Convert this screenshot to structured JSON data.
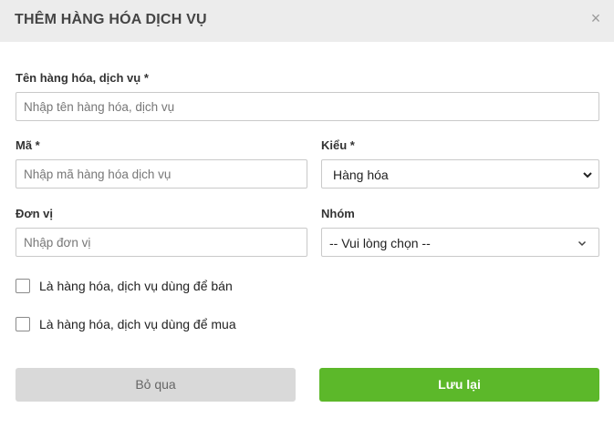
{
  "dialog": {
    "title": "THÊM HÀNG HÓA DỊCH VỤ",
    "close_glyph": "×"
  },
  "form": {
    "name": {
      "label": "Tên hàng hóa, dịch vụ *",
      "placeholder": "Nhập tên hàng hóa, dịch vụ",
      "value": ""
    },
    "code": {
      "label": "Mã *",
      "placeholder": "Nhập mã hàng hóa dịch vụ",
      "value": ""
    },
    "type": {
      "label": "Kiểu *",
      "selected": "Hàng hóa"
    },
    "unit": {
      "label": "Đơn vị",
      "placeholder": "Nhập đơn vị",
      "value": ""
    },
    "group": {
      "label": "Nhóm",
      "selected": "-- Vui lòng chọn --"
    },
    "for_sale": {
      "label": "Là hàng hóa, dịch vụ dùng để bán",
      "checked": false
    },
    "for_purchase": {
      "label": "Là hàng hóa, dịch vụ dùng để mua",
      "checked": false
    }
  },
  "buttons": {
    "cancel_label": "Bỏ qua",
    "save_label": "Lưu lại"
  },
  "colors": {
    "header_bg": "#ececec",
    "primary": "#5cb82a",
    "secondary": "#d9d9d9"
  }
}
